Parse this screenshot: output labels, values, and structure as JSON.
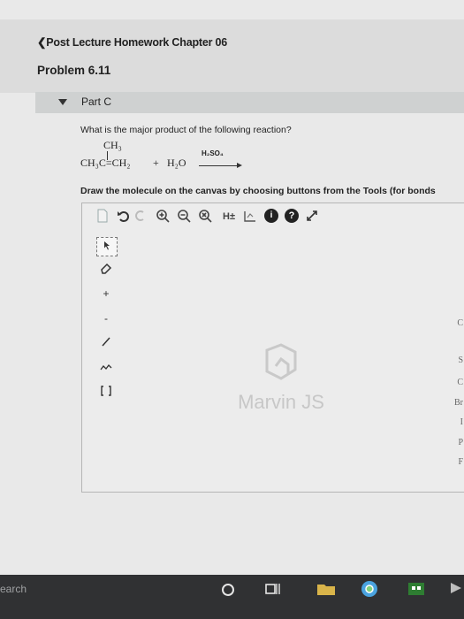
{
  "header": {
    "back_link": "❮Post Lecture Homework Chapter 06",
    "problem_title": "Problem 6.11"
  },
  "part": {
    "label": "Part C"
  },
  "question": "What is the major product of the following reaction?",
  "reaction": {
    "methyl_group": "CH₃",
    "reactant": "CH₃C=CH₂",
    "plus": "+",
    "water": "H₂O",
    "catalyst": "H₂SO₄"
  },
  "instruction": "Draw the molecule on the canvas by choosing buttons from the Tools (for bonds",
  "editor": {
    "toolbar": {
      "h_toggle": "H±",
      "info": "i",
      "help": "?"
    },
    "left_tools": {
      "plus_charge": "+",
      "minus_charge": "-"
    },
    "right_elements": [
      "C",
      "S",
      "C",
      "Br",
      "I",
      "P",
      "F"
    ],
    "watermark": "Marvin JS"
  },
  "taskbar": {
    "search": "earch"
  }
}
